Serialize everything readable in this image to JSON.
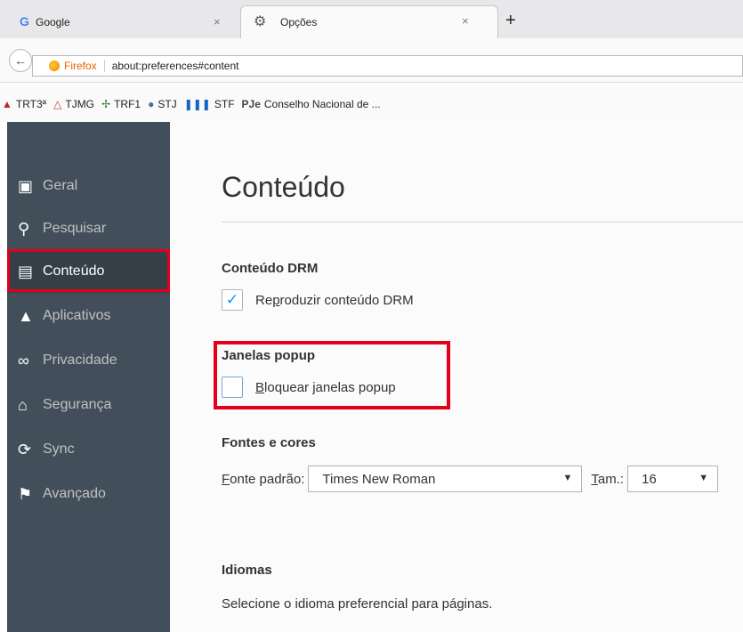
{
  "tabs": [
    {
      "icon": "google-g-icon",
      "icon_glyph": "G",
      "label": "Google",
      "close_glyph": "×"
    },
    {
      "icon": "gear-icon",
      "icon_glyph": "⚙",
      "label": "Opções",
      "close_glyph": "×"
    }
  ],
  "new_tab_glyph": "+",
  "urlbar": {
    "back_glyph": "←",
    "identity_label": "Firefox",
    "url": "about:preferences#content"
  },
  "bookmarks": [
    {
      "icon": "tree-icon",
      "glyph": "▲",
      "label": "TRT3ª"
    },
    {
      "icon": "triangle-icon",
      "glyph": "△",
      "label": "TJMG"
    },
    {
      "icon": "scales-icon",
      "glyph": "✢",
      "label": "TRF1"
    },
    {
      "icon": "seal-icon",
      "glyph": "●",
      "label": "STJ"
    },
    {
      "icon": "columns-icon",
      "glyph": "❚❚❚",
      "label": "STF"
    },
    {
      "icon": "pje-icon",
      "glyph": "PJe",
      "label": "Conselho Nacional de ..."
    }
  ],
  "sidebar": {
    "items": [
      {
        "icon": "geral-icon",
        "glyph": "▣",
        "label": "Geral",
        "selected": false
      },
      {
        "icon": "search-icon",
        "glyph": "⚲",
        "label": "Pesquisar",
        "selected": false
      },
      {
        "icon": "document-icon",
        "glyph": "▤",
        "label": "Conteúdo",
        "selected": true
      },
      {
        "icon": "rocket-icon",
        "glyph": "▲",
        "label": "Aplicativos",
        "selected": false
      },
      {
        "icon": "mask-icon",
        "glyph": "∞",
        "label": "Privacidade",
        "selected": false
      },
      {
        "icon": "lock-icon",
        "glyph": "⌂",
        "label": "Segurança",
        "selected": false
      },
      {
        "icon": "sync-icon",
        "glyph": "⟳",
        "label": "Sync",
        "selected": false
      },
      {
        "icon": "wizard-icon",
        "glyph": "⚑",
        "label": "Avançado",
        "selected": false
      }
    ]
  },
  "content": {
    "title": "Conteúdo",
    "drm": {
      "heading": "Conteúdo DRM",
      "checkbox_label_pre": "Re",
      "checkbox_label_key": "p",
      "checkbox_label_post": "roduzir conteúdo DRM",
      "checked": true,
      "check_glyph": "✓"
    },
    "popups": {
      "heading": "Janelas popup",
      "checkbox_label_key": "B",
      "checkbox_label_post": "loquear janelas popup",
      "checked": false
    },
    "fonts": {
      "heading": "Fontes e cores",
      "default_font_label_key": "F",
      "default_font_label_post": "onte padrão:",
      "default_font_value": "Times New Roman",
      "size_label_key": "T",
      "size_label_post": "am.:",
      "size_value": "16",
      "arrow_glyph": "▼"
    },
    "languages": {
      "heading": "Idiomas",
      "description": "Selecione o idioma preferencial para páginas."
    }
  },
  "colors": {
    "sidebar_bg": "#424f5a",
    "sidebar_selected_bg": "#343f48",
    "highlight_red": "#e3001b",
    "check_blue": "#0996f8"
  }
}
